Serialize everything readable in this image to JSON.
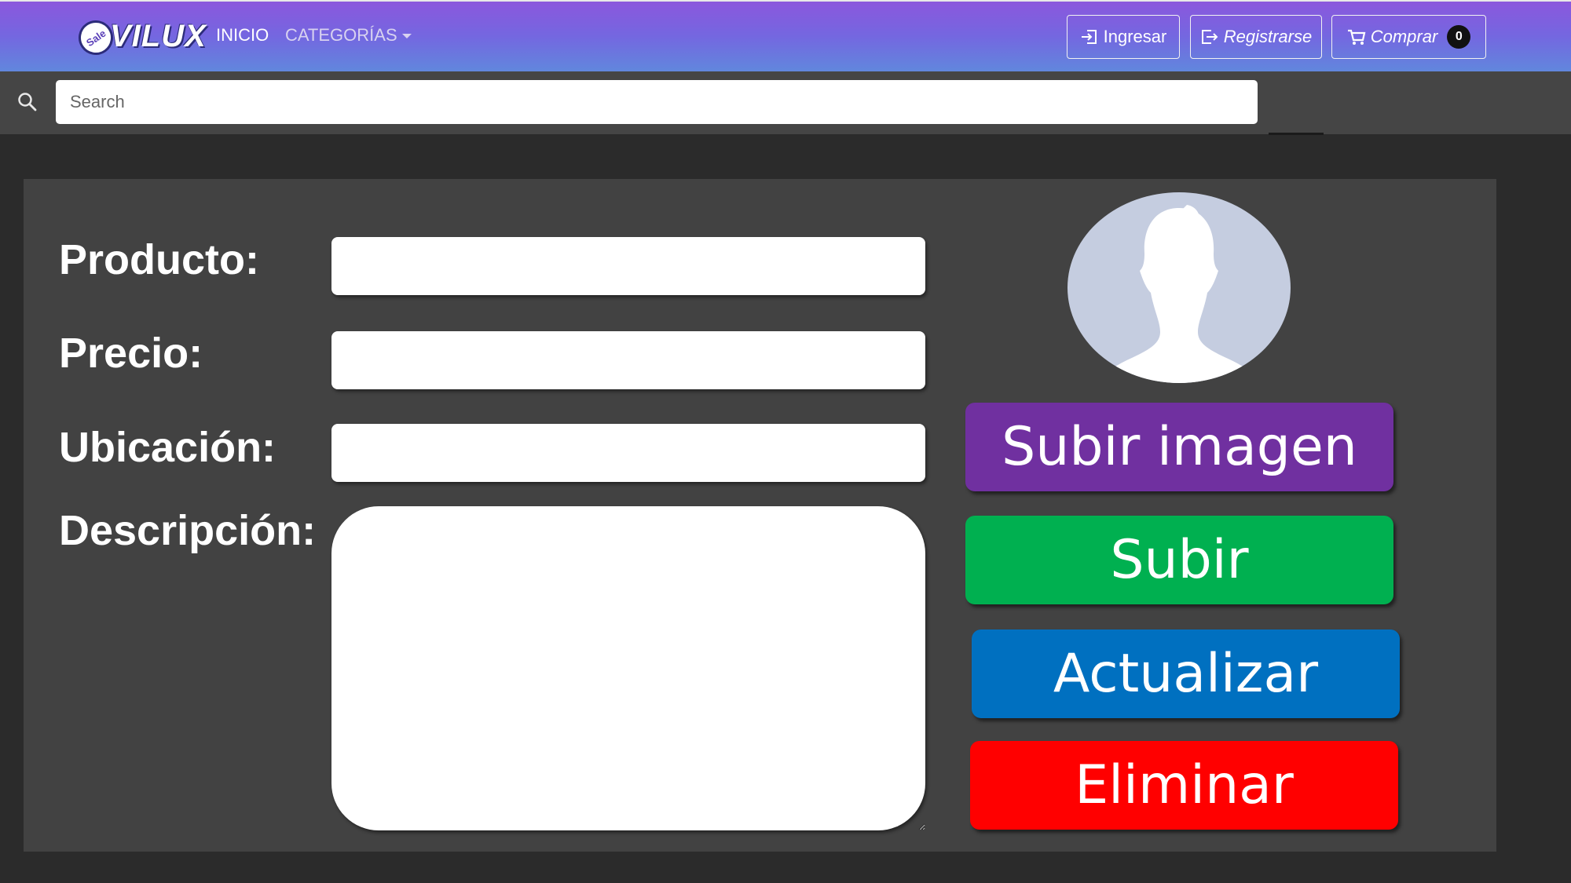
{
  "navbar": {
    "brand": "VILUX",
    "brand_badge": "Sale",
    "links": [
      "INICIO",
      "CATEGORÍAS"
    ],
    "login_label": "Ingresar",
    "register_label": "Registrarse",
    "cart_label": "Comprar",
    "cart_count": "0"
  },
  "search": {
    "placeholder": "Search"
  },
  "form": {
    "labels": {
      "product": "Producto:",
      "price": "Precio:",
      "location": "Ubicación:",
      "description": "Descripción:"
    },
    "buttons": {
      "upload_image": "Subir imagen",
      "upload": "Subir",
      "update": "Actualizar",
      "delete": "Eliminar"
    }
  },
  "colors": {
    "nav_gradient_top": "#8b57dd",
    "nav_gradient_bottom": "#6187dd",
    "upload_image": "#7030a0",
    "upload": "#00b050",
    "update": "#0070c0",
    "delete": "#ff0000"
  },
  "icons": {
    "search": "search-icon",
    "login": "login-icon",
    "register": "register-icon",
    "cart": "cart-icon",
    "avatar": "avatar-placeholder-icon"
  }
}
